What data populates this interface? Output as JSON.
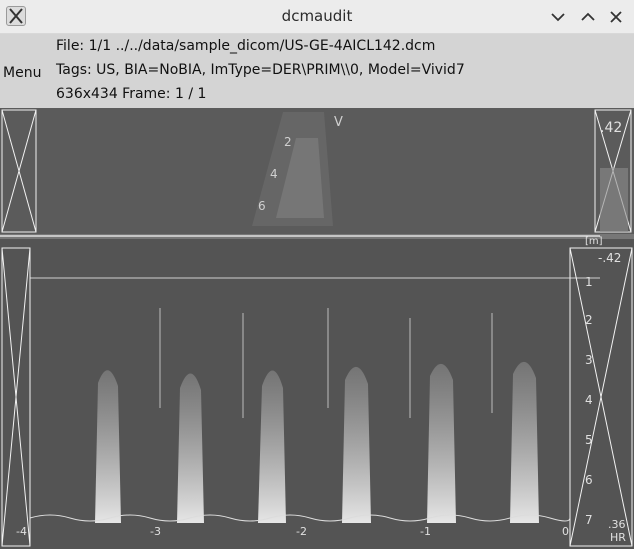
{
  "window": {
    "title": "dcmaudit",
    "app_icon": "x-window-icon",
    "controls": [
      "minimize-icon",
      "maximize-icon",
      "close-icon"
    ]
  },
  "info_panel": {
    "menu_label": "Menu",
    "file_line": "File: 1/1 ../../data/sample_dicom/US-GE-4AICL142.dcm",
    "tags_line": "Tags: US, BIA=NoBIA, ImType=DER\\PRIM\\\\0, Model=Vivid7",
    "dims_line": "636x434 Frame: 1 / 1"
  },
  "image": {
    "top_labels": {
      "marker": "V",
      "depth_ticks": [
        "2",
        "4",
        "6"
      ],
      "right_scale_top": ".42",
      "unit_box": "[m]"
    },
    "doppler_scale_labels": [
      "-.42",
      "1",
      "2",
      "3",
      "4",
      "5",
      "6",
      "7"
    ],
    "bottom_labels": [
      "-4",
      "-3",
      "-2",
      "-1",
      "0"
    ],
    "bottom_right_labels": [
      ".36",
      "HR"
    ],
    "colors": {
      "background": "#5a5a5a",
      "panel": "#d4d4d4",
      "titlebar": "#ececec",
      "overlay": "#ffffff"
    }
  }
}
